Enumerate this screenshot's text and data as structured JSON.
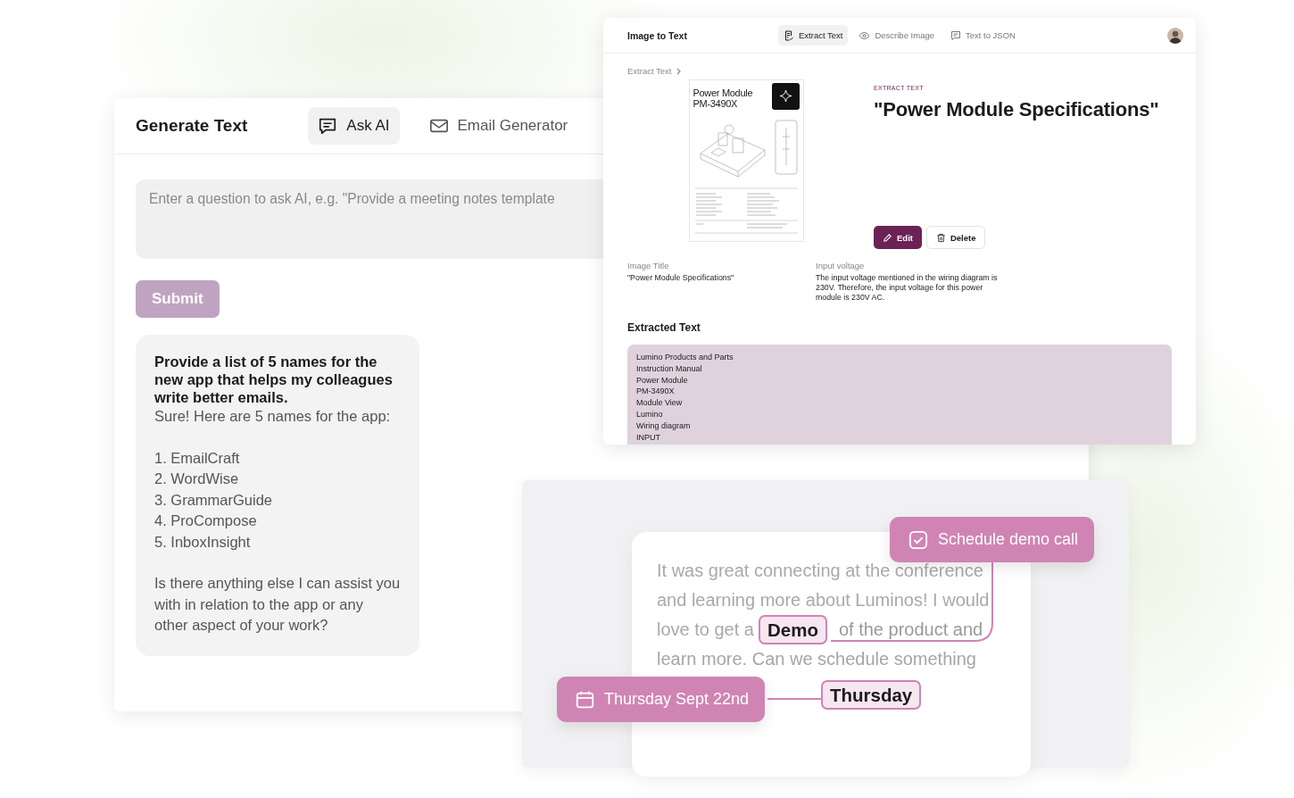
{
  "generate_text": {
    "title": "Generate Text",
    "tabs": [
      {
        "label": "Ask AI",
        "selected": true
      },
      {
        "label": "Email Generator",
        "selected": false
      }
    ],
    "question": {
      "placeholder": "Enter a question to ask AI, e.g. \"Provide a meeting notes template"
    },
    "submit": "Submit",
    "chat": {
      "question": "Provide a list of 5 names for the new app that helps my colleagues write better emails.",
      "intro": "Sure! Here are 5 names for the app:",
      "names": [
        "1. EmailCraft",
        "2. WordWise",
        "3. GrammarGuide",
        "4. ProCompose",
        "5. InboxInsight"
      ],
      "closing": "Is there anything else I can assist you with in relation to the app or any other aspect of your work?"
    }
  },
  "image_to_text": {
    "title": "Image to Text",
    "tabs": [
      {
        "label": "Extract Text",
        "selected": true
      },
      {
        "label": "Describe Image",
        "selected": false
      },
      {
        "label": "Text to JSON",
        "selected": false
      }
    ],
    "breadcrumb": "Extract Text",
    "document": {
      "heading": [
        "Power Module",
        "PM-3490X"
      ]
    },
    "eyebrow": "EXTRACT TEXT",
    "heading": "\"Power Module Specifications\"",
    "buttons": [
      "Edit",
      "Delete"
    ],
    "fields": [
      {
        "label": "Image Title",
        "value": "\"Power Module Specifications\""
      },
      {
        "label": "Input voltage",
        "value": "The input voltage mentioned in the wiring diagram is 230V. Therefore, the input voltage for this power module is 230V AC."
      }
    ],
    "extracted_title": "Extracted Text",
    "extracted_lines": [
      "Lumino Products and Parts",
      "Instruction Manual",
      "Power Module",
      "PM-3490X",
      "Module View",
      "Lumino",
      "Wiring diagram",
      "INPUT"
    ]
  },
  "email_insights": {
    "lines": [
      "It was great connecting at the conference",
      "and learning more about Luminos! I would",
      "love to get a",
      "of the product and",
      "learn more. Can we schedule something"
    ],
    "highlights": [
      "Demo",
      "Thursday"
    ],
    "actions": [
      "Schedule demo call",
      "Thursday Sept 22nd"
    ]
  }
}
